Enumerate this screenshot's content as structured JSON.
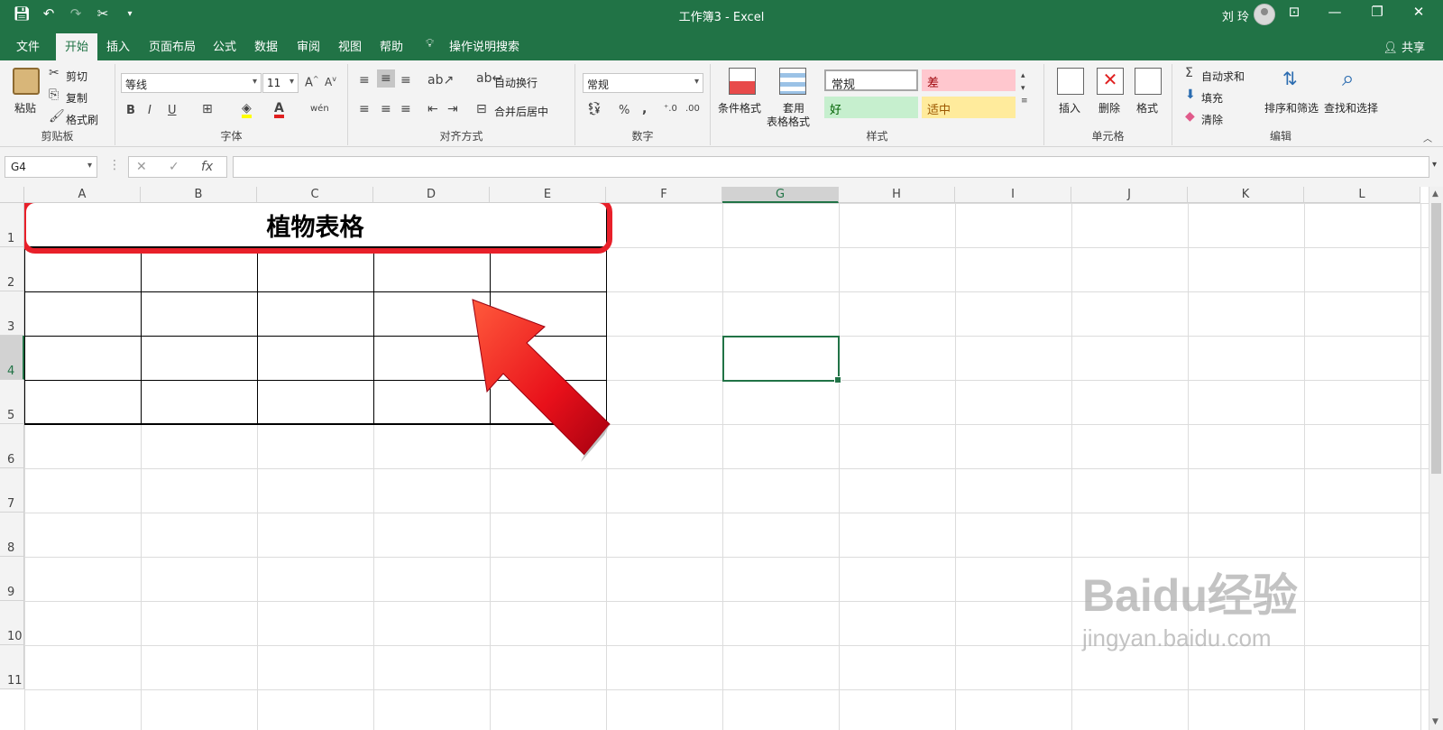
{
  "window": {
    "title": "工作簿3  -  Excel",
    "user": "刘 玲"
  },
  "tabs": [
    "文件",
    "开始",
    "插入",
    "页面布局",
    "公式",
    "数据",
    "审阅",
    "视图",
    "帮助"
  ],
  "tell_me": "操作说明搜索",
  "share": "共享",
  "ribbon": {
    "clipboard": {
      "paste": "粘贴",
      "cut": "剪切",
      "copy": "复制",
      "format_painter": "格式刷",
      "label": "剪贴板"
    },
    "font": {
      "name": "等线",
      "size": "11",
      "label": "字体",
      "bold": "B",
      "italic": "I",
      "underline": "U",
      "phonetic": "wén"
    },
    "alignment": {
      "wrap": "自动换行",
      "merge": "合并后居中",
      "label": "对齐方式"
    },
    "number": {
      "format": "常规",
      "percent": "%",
      "comma": ",",
      "label": "数字"
    },
    "styles": {
      "conditional": "条件格式",
      "table_line1": "套用",
      "table_line2": "表格格式",
      "normal": "常规",
      "bad": "差",
      "good": "好",
      "neutral": "适中",
      "label": "样式",
      "bad_color": "#ffc7ce",
      "good_color": "#c6efce",
      "neutral_color": "#ffeb9c"
    },
    "cells": {
      "insert": "插入",
      "delete": "删除",
      "format": "格式",
      "label": "单元格"
    },
    "editing": {
      "autosum": "自动求和",
      "fill": "填充",
      "clear": "清除",
      "sort": "排序和筛选",
      "find": "查找和选择",
      "label": "编辑"
    }
  },
  "formula_bar": {
    "name_box": "G4",
    "fx": "fx",
    "cancel": "✕",
    "enter": "✓"
  },
  "sheet": {
    "columns": [
      "A",
      "B",
      "C",
      "D",
      "E",
      "F",
      "G",
      "H",
      "I",
      "J",
      "K",
      "L"
    ],
    "rows": [
      "1",
      "2",
      "3",
      "4",
      "5",
      "6",
      "7",
      "8",
      "9",
      "10",
      "11"
    ],
    "merged_title": "植物表格",
    "selected_cell": "G4"
  },
  "watermark": {
    "brand": "Baidu经验",
    "url": "jingyan.baidu.com"
  },
  "colors": {
    "excel_green": "#217346",
    "highlight_red": "#e8202a"
  }
}
